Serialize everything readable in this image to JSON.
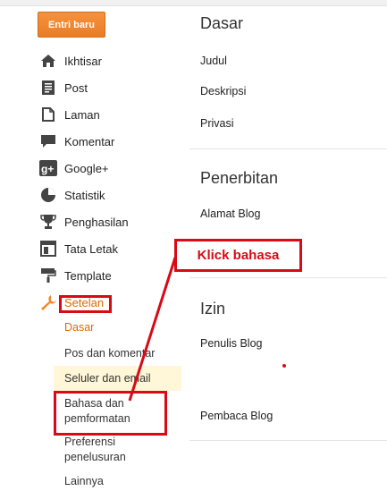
{
  "new_post_label": "Entri baru",
  "nav": [
    {
      "label": "Ikhtisar",
      "icon": "home-icon"
    },
    {
      "label": "Post",
      "icon": "posts-icon"
    },
    {
      "label": "Laman",
      "icon": "pages-icon"
    },
    {
      "label": "Komentar",
      "icon": "comment-icon"
    },
    {
      "label": "Google+",
      "icon": "google-plus-icon"
    },
    {
      "label": "Statistik",
      "icon": "pie-chart-icon"
    },
    {
      "label": "Penghasilan",
      "icon": "trophy-icon"
    },
    {
      "label": "Tata Letak",
      "icon": "layout-icon"
    },
    {
      "label": "Template",
      "icon": "paint-roller-icon"
    },
    {
      "label": "Setelan",
      "icon": "wrench-icon"
    }
  ],
  "settings_sub": {
    "basic": "Dasar",
    "posts_comments": "Pos dan komentar",
    "mobile_email": "Seluler dan email",
    "language_line1": "Bahasa dan",
    "language_line2": "pemformatan",
    "search_line1": "Preferensi",
    "search_line2": "penelusuran",
    "other": "Lainnya"
  },
  "sections": {
    "basic": {
      "title": "Dasar",
      "items": [
        "Judul",
        "Deskripsi",
        "Privasi"
      ]
    },
    "publishing": {
      "title": "Penerbitan",
      "items": [
        "Alamat Blog"
      ]
    },
    "permissions": {
      "title": "Izin",
      "items": [
        "Penulis Blog",
        "Pembaca Blog"
      ]
    }
  },
  "annotation": {
    "label": "Klick bahasa",
    "color": "#d80a15"
  },
  "colors": {
    "accent_orange": "#f0882f",
    "active_sub": "#dd6a00",
    "highlight_row": "#fff7d7"
  }
}
